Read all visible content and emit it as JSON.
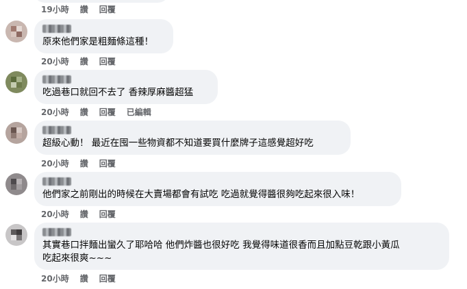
{
  "top_meta": {
    "time": "19小時",
    "like": "讚",
    "reply": "回覆"
  },
  "comments": [
    {
      "text": "原來他們家是粗麵條這種！",
      "time": "20小時",
      "like": "讚",
      "reply": "回覆",
      "edited": ""
    },
    {
      "text": "吃過巷口就回不去了 香辣厚麻醬超猛",
      "time": "20小時",
      "like": "讚",
      "reply": "回覆",
      "edited": "已編輯"
    },
    {
      "text": "超級心動！ 最近在囤一些物資都不知道要買什麼牌子這感覺超好吃",
      "time": "20小時",
      "like": "讚",
      "reply": "回覆",
      "edited": ""
    },
    {
      "text": "他們家之前剛出的時候在大賣場都會有試吃 吃過就覺得醬很夠吃起來很入味！",
      "time": "20小時",
      "like": "讚",
      "reply": "回覆",
      "edited": ""
    },
    {
      "text_line1": "其實巷口拌麵出蠻久了耶哈哈 他們炸醬也很好吃 我覺得味道很香而且加點豆乾跟小黃瓜",
      "text_line2": "吃起來很爽~~~",
      "time": "20小時",
      "like": "讚",
      "reply": "回覆",
      "edited": ""
    }
  ],
  "colors": {
    "bubble": "#f0f2f5",
    "meta_text": "#65676b",
    "body_text": "#050505"
  }
}
